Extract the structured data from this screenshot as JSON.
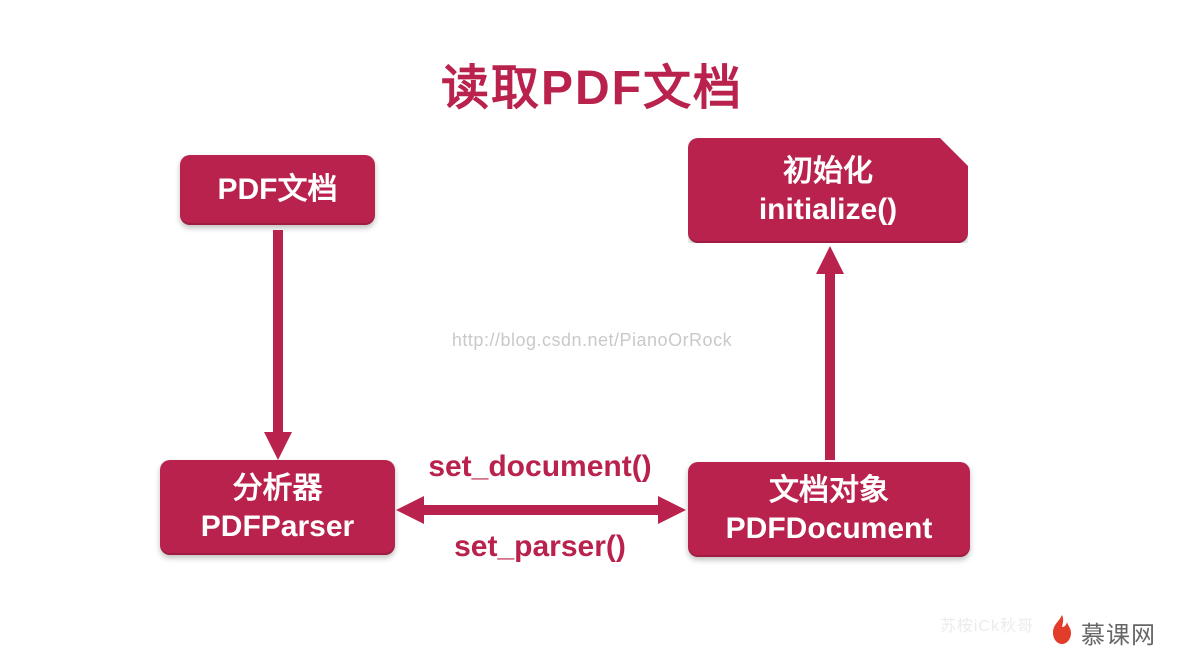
{
  "title": "读取PDF文档",
  "nodes": {
    "pdf": {
      "line1": "PDF文档"
    },
    "parser": {
      "line1": "分析器",
      "line2": "PDFParser"
    },
    "init": {
      "line1": "初始化",
      "line2": "initialize()"
    },
    "doc": {
      "line1": "文档对象",
      "line2": "PDFDocument"
    }
  },
  "connectors": {
    "set_document_label": "set_document()",
    "set_parser_label": "set_parser()"
  },
  "watermark": "http://blog.csdn.net/PianoOrRock",
  "branding": {
    "text": "慕课网"
  },
  "faint_mark": "苏桉iCk秋哥",
  "colors": {
    "accent": "#b9224c"
  }
}
